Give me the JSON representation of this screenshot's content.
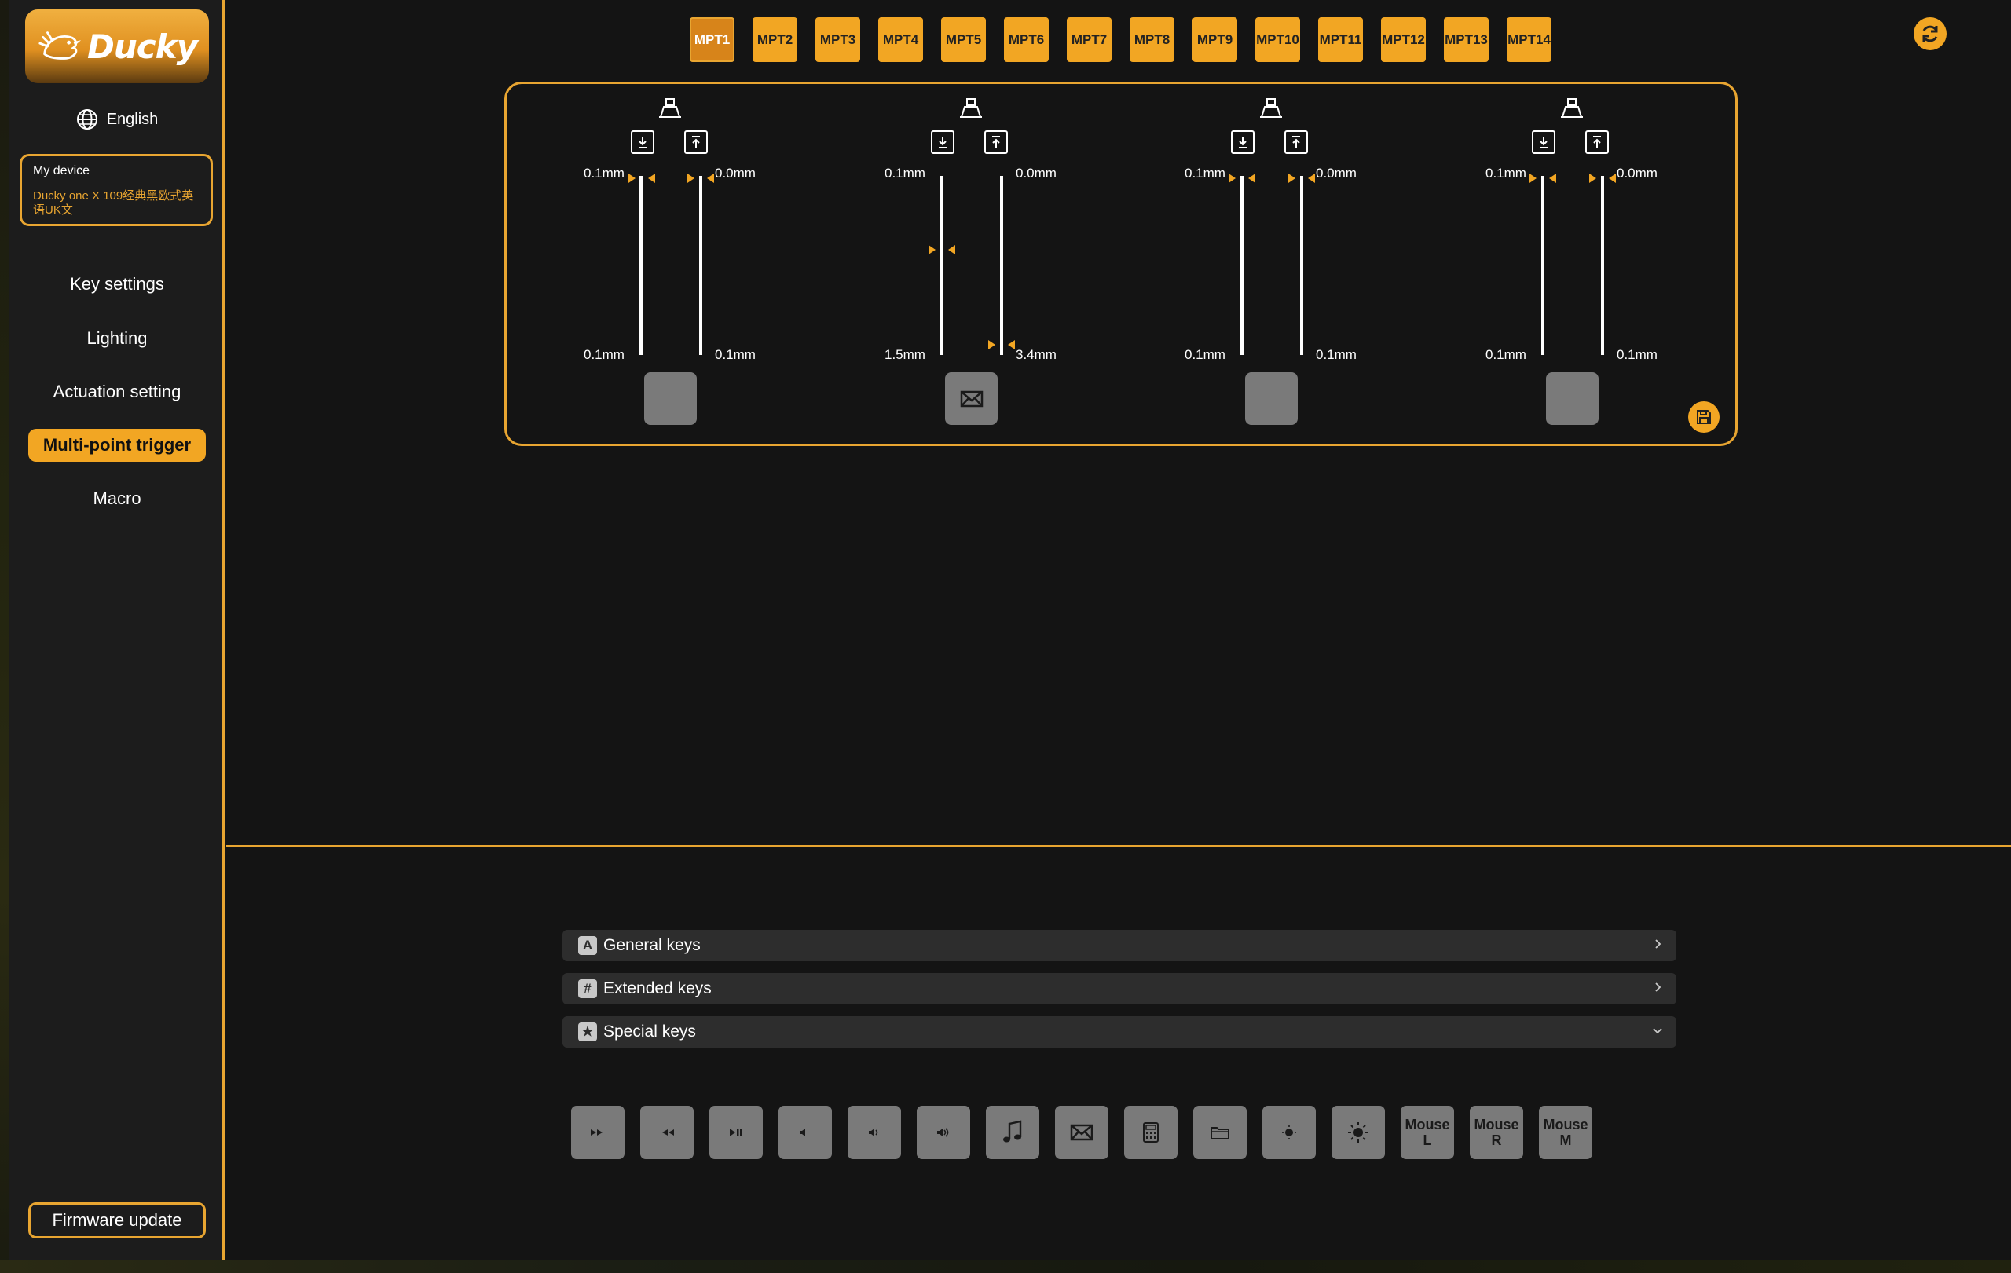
{
  "app": {
    "brand": "Ducky"
  },
  "sidebar": {
    "language": "English",
    "device_label": "My device",
    "device_name": "Ducky one X 109经典黑欧式英语UK文",
    "items": [
      {
        "label": "Key settings"
      },
      {
        "label": "Lighting"
      },
      {
        "label": "Actuation setting"
      },
      {
        "label": "Multi-point trigger",
        "active": true
      },
      {
        "label": "Macro"
      }
    ],
    "firmware_label": "Firmware update"
  },
  "tabs": [
    {
      "label": "MPT1",
      "active": true
    },
    {
      "label": "MPT2"
    },
    {
      "label": "MPT3"
    },
    {
      "label": "MPT4"
    },
    {
      "label": "MPT5"
    },
    {
      "label": "MPT6"
    },
    {
      "label": "MPT7"
    },
    {
      "label": "MPT8"
    },
    {
      "label": "MPT9"
    },
    {
      "label": "MPT10"
    },
    {
      "label": "MPT11"
    },
    {
      "label": "MPT12"
    },
    {
      "label": "MPT13"
    },
    {
      "label": "MPT14"
    }
  ],
  "triggers": [
    {
      "press_top": "0.1mm",
      "press_bottom": "0.1mm",
      "release_top": "0.0mm",
      "release_bottom": "0.1mm",
      "keycap_icon": ""
    },
    {
      "press_top": "0.1mm",
      "press_bottom": "1.5mm",
      "release_top": "0.0mm",
      "release_bottom": "3.4mm",
      "keycap_icon": "mail-icon"
    },
    {
      "press_top": "0.1mm",
      "press_bottom": "0.1mm",
      "release_top": "0.0mm",
      "release_bottom": "0.1mm",
      "keycap_icon": ""
    },
    {
      "press_top": "0.1mm",
      "press_bottom": "0.1mm",
      "release_top": "0.0mm",
      "release_bottom": "0.1mm",
      "keycap_icon": ""
    }
  ],
  "categories": [
    {
      "icon": "A",
      "label": "General keys",
      "expanded": false
    },
    {
      "icon": "#",
      "label": "Extended keys",
      "expanded": false
    },
    {
      "icon": "★",
      "label": "Special keys",
      "expanded": true
    }
  ],
  "special_keys": [
    {
      "icon": "next-track-icon"
    },
    {
      "icon": "previous-track-icon"
    },
    {
      "icon": "play-pause-icon"
    },
    {
      "icon": "volume-mute-icon"
    },
    {
      "icon": "volume-down-icon"
    },
    {
      "icon": "volume-up-icon"
    },
    {
      "icon": "music-icon"
    },
    {
      "icon": "mail-icon"
    },
    {
      "icon": "calculator-icon"
    },
    {
      "icon": "folder-icon"
    },
    {
      "icon": "brightness-down-icon"
    },
    {
      "icon": "brightness-up-icon"
    },
    {
      "label": "Mouse L"
    },
    {
      "label": "Mouse R"
    },
    {
      "label": "Mouse M"
    }
  ],
  "colors": {
    "accent": "#f2a623",
    "background": "#141414",
    "sidebar": "#1c1c1c"
  }
}
